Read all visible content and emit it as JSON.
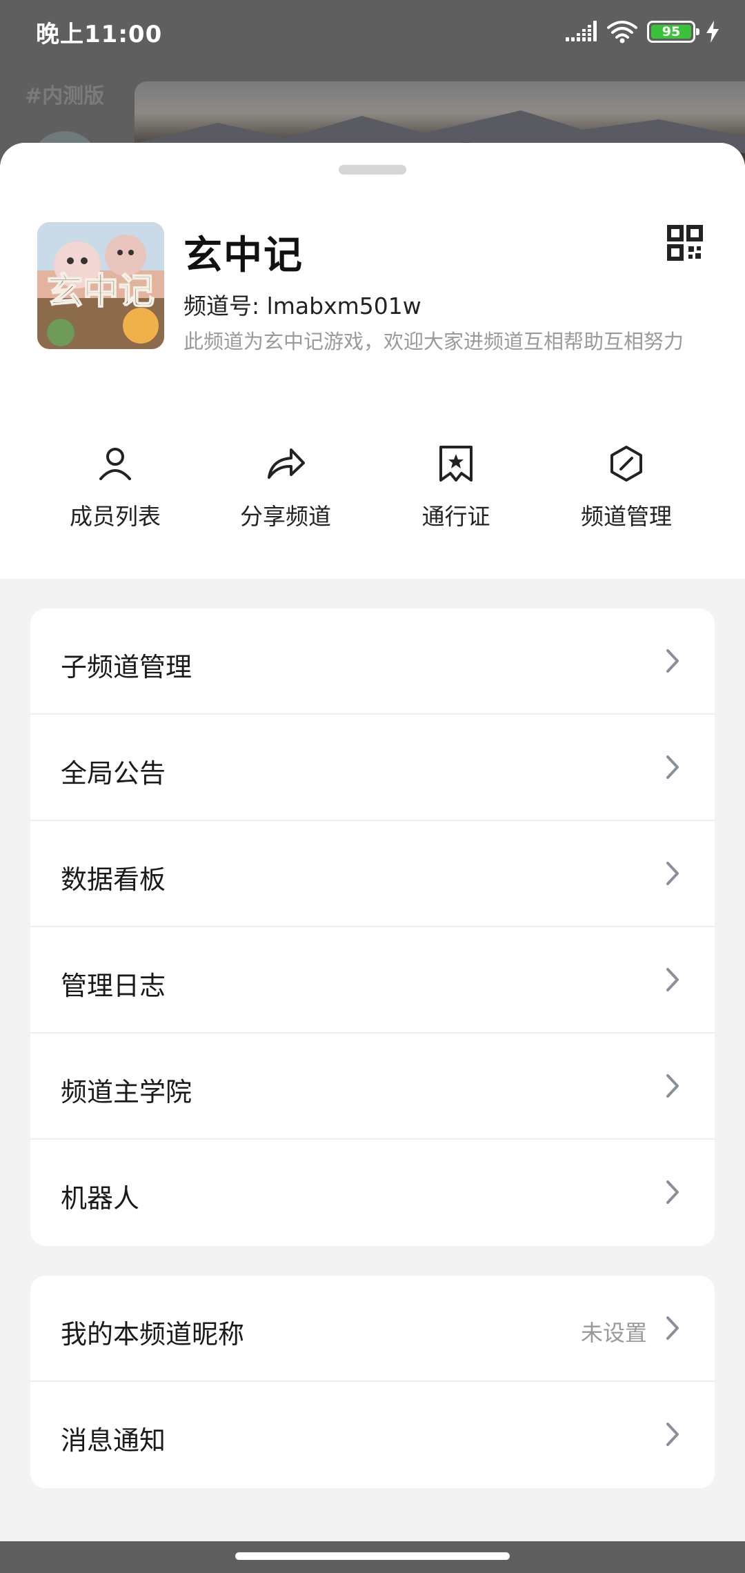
{
  "status_bar": {
    "time": "晚上11:00",
    "battery_level": "95",
    "colors": {
      "battery": "#3cc13b"
    }
  },
  "background_page": {
    "label": "#内测版"
  },
  "channel": {
    "name": "玄中记",
    "id_line": "频道号: lmabxm501w",
    "description": "此频道为玄中记游戏，欢迎大家进频道互相帮助互相努力",
    "avatar_icon": "game-cover-image",
    "qr_icon": "qr-code-icon"
  },
  "actions": [
    {
      "label": "成员列表",
      "icon": "person-icon"
    },
    {
      "label": "分享频道",
      "icon": "share-arrow-icon"
    },
    {
      "label": "通行证",
      "icon": "ticket-icon"
    },
    {
      "label": "频道管理",
      "icon": "hexagon-manage-icon"
    }
  ],
  "menu_main": [
    {
      "label": "子频道管理"
    },
    {
      "label": "全局公告"
    },
    {
      "label": "数据看板"
    },
    {
      "label": "管理日志"
    },
    {
      "label": "频道主学院"
    },
    {
      "label": "机器人"
    }
  ],
  "menu_personal": [
    {
      "label": "我的本频道昵称",
      "value": "未设置"
    },
    {
      "label": "消息通知"
    }
  ],
  "colors": {
    "sheet_background": "#f3f3f4",
    "card_background": "#ffffff",
    "chevron": "#8a8f9c",
    "secondary_text": "#9a9a9a"
  }
}
